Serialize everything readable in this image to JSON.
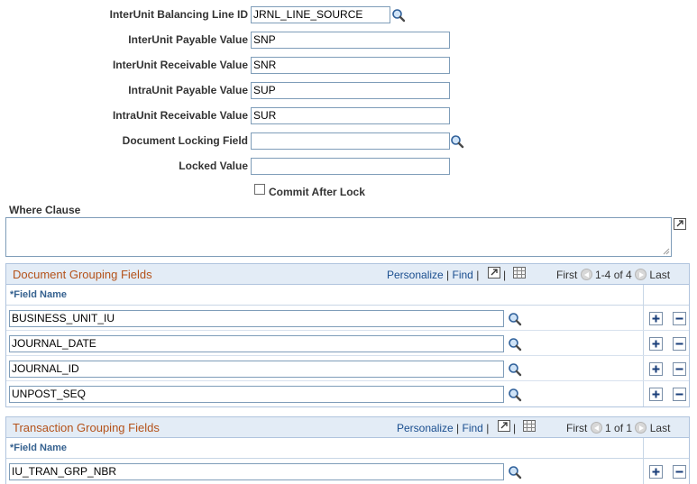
{
  "fields": {
    "balancing_line_id": {
      "label": "InterUnit Balancing Line ID",
      "value": "JRNL_LINE_SOURCE"
    },
    "payable_value": {
      "label": "InterUnit Payable Value",
      "value": "SNP"
    },
    "receivable_value": {
      "label": "InterUnit Receivable Value",
      "value": "SNR"
    },
    "intra_payable_value": {
      "label": "IntraUnit Payable Value",
      "value": "SUP"
    },
    "intra_receivable_value": {
      "label": "IntraUnit Receivable Value",
      "value": "SUR"
    },
    "doc_locking_field": {
      "label": "Document Locking Field",
      "value": ""
    },
    "locked_value": {
      "label": "Locked Value",
      "value": ""
    }
  },
  "commit_after_lock": {
    "label": "Commit After Lock",
    "checked": false
  },
  "where_clause": {
    "label": "Where Clause",
    "value": ""
  },
  "doc_grid": {
    "title": "Document Grouping Fields",
    "personalize": "Personalize",
    "find": "Find",
    "first": "First",
    "range": "1-4 of 4",
    "last": "Last",
    "col_header": "*Field Name",
    "rows": [
      "BUSINESS_UNIT_IU",
      "JOURNAL_DATE",
      "JOURNAL_ID",
      "UNPOST_SEQ"
    ]
  },
  "tran_grid": {
    "title": "Transaction Grouping Fields",
    "personalize": "Personalize",
    "find": "Find",
    "first": "First",
    "range": "1 of 1",
    "last": "Last",
    "col_header": "*Field Name",
    "rows": [
      "IU_TRAN_GRP_NBR"
    ]
  },
  "separator": "|",
  "icons": {
    "lookup": "magnifier-icon",
    "expand": "expand-textarea-icon",
    "view_all": "view-all-icon",
    "download": "grid-download-icon",
    "add": "plus-icon",
    "delete": "minus-icon"
  },
  "colors": {
    "grid_title": "#b4521a",
    "link": "#1a4e8f",
    "header_bg": "#e3ecf6"
  }
}
